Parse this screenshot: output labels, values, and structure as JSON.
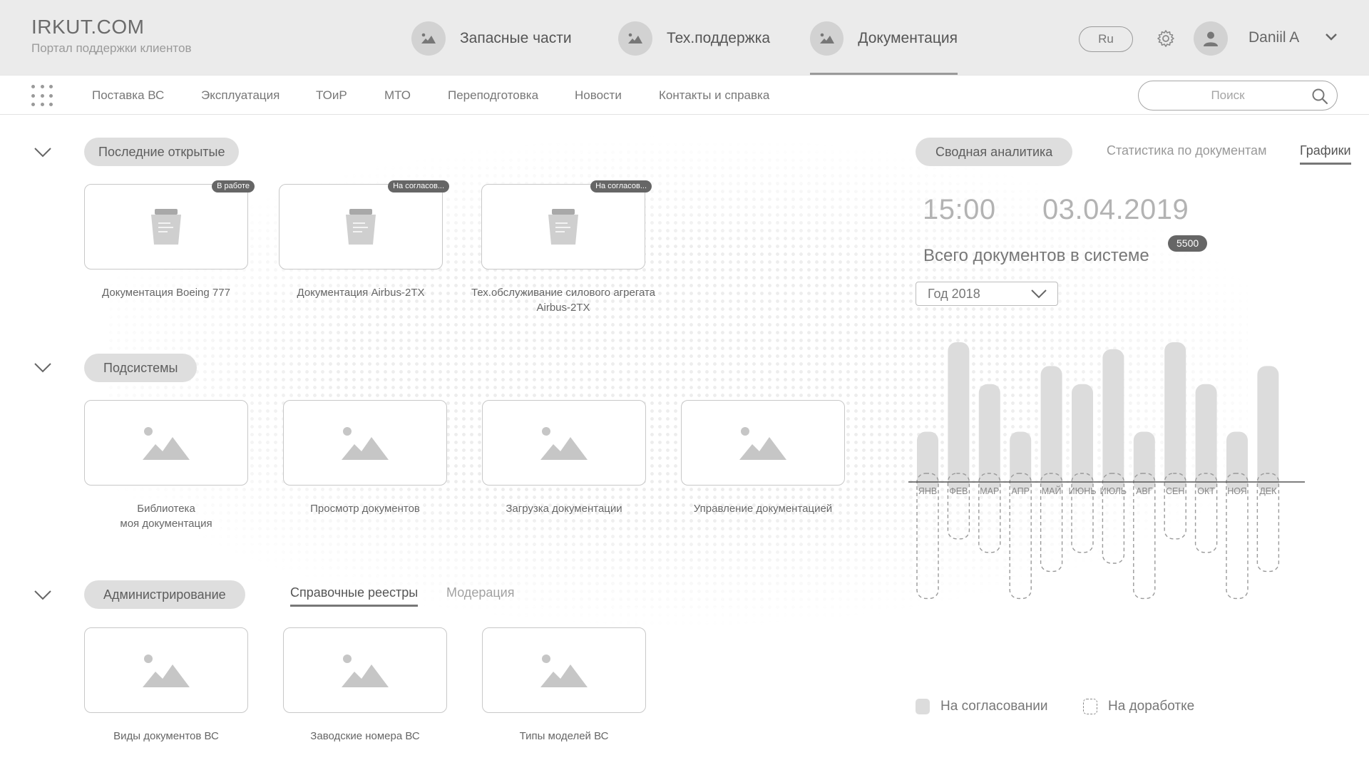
{
  "brand": {
    "title": "IRKUT.COM",
    "subtitle": "Портал поддержки клиентов"
  },
  "top_tabs": [
    {
      "label": "Запасные части",
      "active": false
    },
    {
      "label": "Тех.поддержка",
      "active": false
    },
    {
      "label": "Документация",
      "active": true
    }
  ],
  "header_right": {
    "language": "Ru",
    "user_name": "Daniil A"
  },
  "nav": {
    "items": [
      "Поставка ВС",
      "Эксплуатация",
      "ТОиР",
      "МТО",
      "Переподготовка",
      "Новости",
      "Контакты и справка"
    ],
    "search_placeholder": "Поиск"
  },
  "recent": {
    "title": "Последние открытые",
    "cards": [
      {
        "badge": "В работе",
        "caption": "Документация Boeing 777"
      },
      {
        "badge": "На согласов...",
        "caption": "Документация Airbus-2TX"
      },
      {
        "badge": "На согласов...",
        "caption": "Тех.обслуживание силового агрегата Airbus-2TX"
      }
    ]
  },
  "subsystems": {
    "title": "Подсистемы",
    "cards": [
      {
        "caption": "Библиотека\nмоя документация"
      },
      {
        "caption": "Просмотр документов"
      },
      {
        "caption": "Загрузка документации"
      },
      {
        "caption": "Управление документацией"
      }
    ]
  },
  "admin": {
    "title": "Администрирование",
    "tabs": [
      {
        "label": "Справочные реестры",
        "active": true
      },
      {
        "label": "Модерация",
        "active": false
      }
    ],
    "cards": [
      {
        "caption": "Виды документов ВС"
      },
      {
        "caption": "Заводские номера ВС"
      },
      {
        "caption": "Типы моделей ВС"
      }
    ]
  },
  "analytics": {
    "summary_button": "Сводная аналитика",
    "tabs": [
      {
        "label": "Статистика по документам",
        "active": false
      },
      {
        "label": "Графики",
        "active": true
      }
    ],
    "time": "15:00",
    "date": "03.04.2019",
    "total_label": "Всего документов в системе",
    "total_count": "5500",
    "year_select": "Год 2018"
  },
  "chart_data": {
    "type": "bar",
    "categories": [
      "ЯНВ",
      "ФЕВ",
      "МАР",
      "АПР",
      "МАЙ",
      "ИЮНЬ",
      "ИЮЛЬ",
      "АВГ",
      "СЕН",
      "ОКТ",
      "НОЯ",
      "ДЕК"
    ],
    "series": [
      {
        "name": "На согласовании",
        "values": [
          0.36,
          1.0,
          0.7,
          0.36,
          0.83,
          0.7,
          0.95,
          0.36,
          1.0,
          0.7,
          0.36,
          0.83
        ],
        "style": "filled",
        "color": "#dcdcdc"
      },
      {
        "name": "На доработке",
        "values": [
          0.86,
          0.42,
          0.52,
          0.86,
          0.66,
          0.52,
          0.6,
          0.86,
          0.42,
          0.52,
          0.86,
          0.66
        ],
        "style": "dashed",
        "color": "#9a9a9a"
      }
    ],
    "ylim": [
      0,
      1
    ],
    "legend": "bottom"
  },
  "colors": {
    "header_bg": "#ebebeb",
    "pill_bg": "#dedede",
    "badge_bg": "#666666",
    "bar_fill": "#dcdcdc"
  }
}
